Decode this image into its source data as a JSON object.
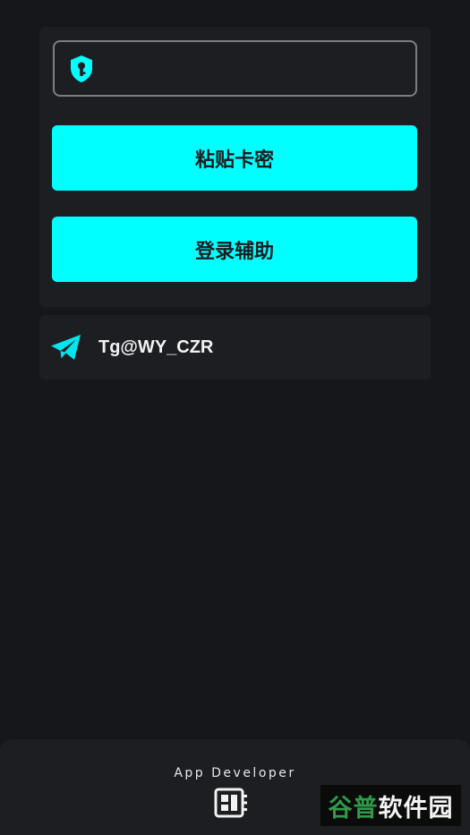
{
  "login": {
    "key_input_value": "",
    "key_input_placeholder": "",
    "paste_button_label": "粘贴卡密",
    "login_button_label": "登录辅助"
  },
  "contact": {
    "telegram_label": "Tg@WY_CZR"
  },
  "footer": {
    "developer_label": "App Developer"
  },
  "watermark": {
    "part1": "谷普",
    "part2": "软件园"
  },
  "colors": {
    "background": "#16171a",
    "card": "#1d1e22",
    "accent": "#00ffff",
    "button_text": "#1b1c20",
    "field_border": "#7d7e83"
  },
  "icons": {
    "key_field": "shield-key-icon",
    "contact": "telegram-icon",
    "developer": "developer-board-icon"
  }
}
